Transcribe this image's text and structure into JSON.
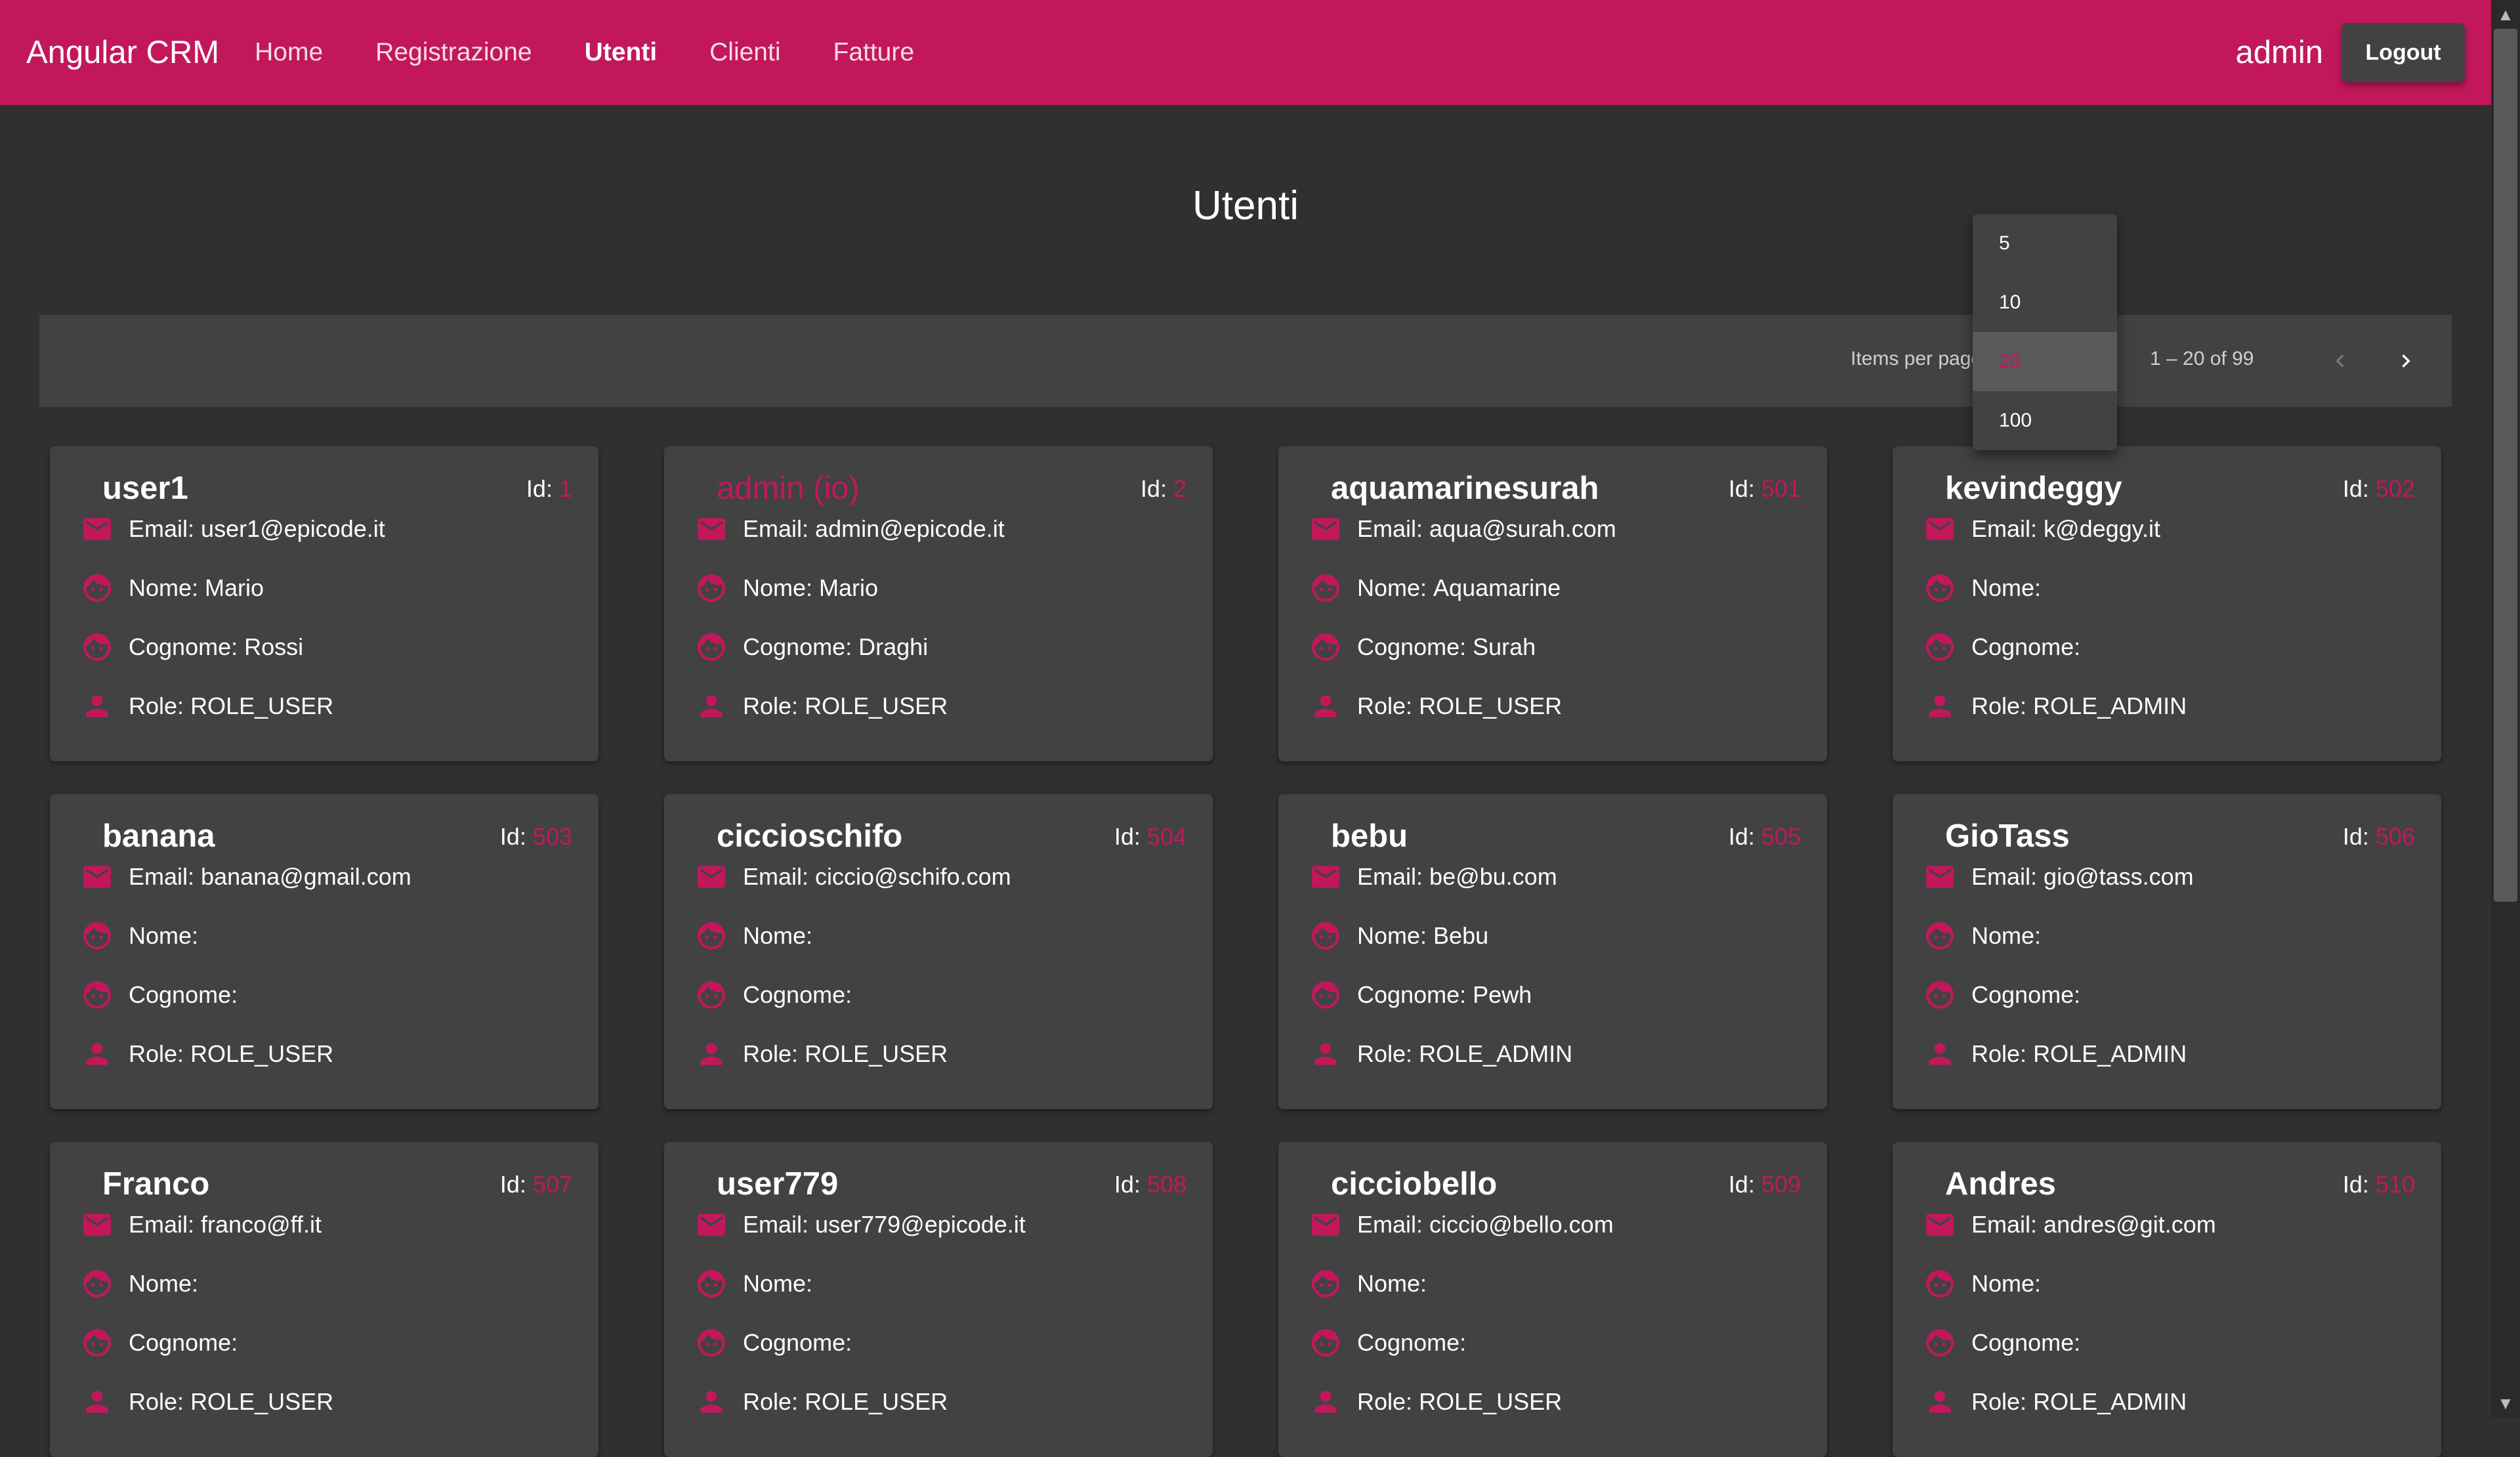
{
  "app": {
    "title": "Angular CRM",
    "accent_color": "#c2185b"
  },
  "nav": [
    {
      "label": "Home",
      "active": false
    },
    {
      "label": "Registrazione",
      "active": false
    },
    {
      "label": "Utenti",
      "active": true
    },
    {
      "label": "Clienti",
      "active": false
    },
    {
      "label": "Fatture",
      "active": false
    }
  ],
  "header": {
    "username": "admin",
    "logout_label": "Logout"
  },
  "page": {
    "title": "Utenti"
  },
  "paginator": {
    "items_per_page_label": "Items per page:",
    "range_label": "1 – 20 of 99",
    "page_size_options": [
      "5",
      "10",
      "20",
      "100"
    ],
    "selected_page_size": "20"
  },
  "labels": {
    "id": "Id:",
    "email": "Email:",
    "nome": "Nome:",
    "cognome": "Cognome:",
    "role": "Role:"
  },
  "icons": [
    "mail-icon",
    "face-icon",
    "person-icon",
    "chevron-left-icon",
    "chevron-right-icon"
  ],
  "users": [
    {
      "username": "user1",
      "id": "1",
      "email": "user1@epicode.it",
      "nome": "Mario",
      "cognome": "Rossi",
      "role": "ROLE_USER",
      "self": false
    },
    {
      "username": "admin (io)",
      "id": "2",
      "email": "admin@epicode.it",
      "nome": "Mario",
      "cognome": "Draghi",
      "role": "ROLE_USER",
      "self": true
    },
    {
      "username": "aquamarinesurah",
      "id": "501",
      "email": "aqua@surah.com",
      "nome": "Aquamarine",
      "cognome": "Surah",
      "role": "ROLE_USER",
      "self": false
    },
    {
      "username": "kevindeggy",
      "id": "502",
      "email": "k@deggy.it",
      "nome": "",
      "cognome": "",
      "role": "ROLE_ADMIN",
      "self": false
    },
    {
      "username": "banana",
      "id": "503",
      "email": "banana@gmail.com",
      "nome": "",
      "cognome": "",
      "role": "ROLE_USER",
      "self": false
    },
    {
      "username": "ciccioschifo",
      "id": "504",
      "email": "ciccio@schifo.com",
      "nome": "",
      "cognome": "",
      "role": "ROLE_USER",
      "self": false
    },
    {
      "username": "bebu",
      "id": "505",
      "email": "be@bu.com",
      "nome": "Bebu",
      "cognome": "Pewh",
      "role": "ROLE_ADMIN",
      "self": false
    },
    {
      "username": "GioTass",
      "id": "506",
      "email": "gio@tass.com",
      "nome": "",
      "cognome": "",
      "role": "ROLE_ADMIN",
      "self": false
    },
    {
      "username": "Franco",
      "id": "507",
      "email": "franco@ff.it",
      "nome": "",
      "cognome": "",
      "role": "ROLE_USER",
      "self": false
    },
    {
      "username": "user779",
      "id": "508",
      "email": "user779@epicode.it",
      "nome": "",
      "cognome": "",
      "role": "ROLE_USER",
      "self": false
    },
    {
      "username": "cicciobello",
      "id": "509",
      "email": "ciccio@bello.com",
      "nome": "",
      "cognome": "",
      "role": "ROLE_USER",
      "self": false
    },
    {
      "username": "Andres",
      "id": "510",
      "email": "andres@git.com",
      "nome": "",
      "cognome": "",
      "role": "ROLE_ADMIN",
      "self": false
    }
  ]
}
